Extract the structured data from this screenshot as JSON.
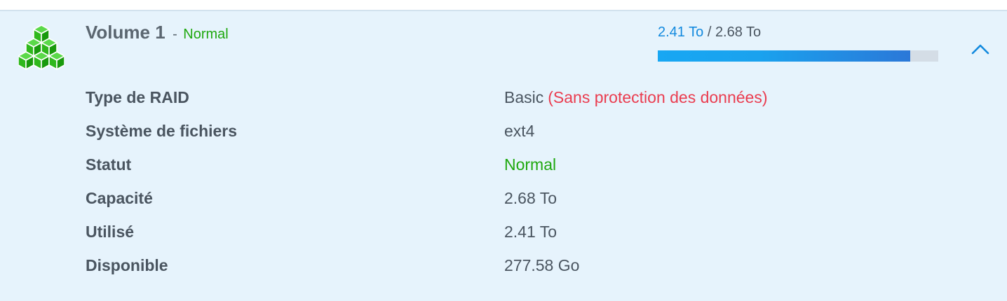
{
  "volume": {
    "name": "Volume 1",
    "separator": "-",
    "status": "Normal",
    "icon": "cubes-icon",
    "icon_color": "#22b60f"
  },
  "usage": {
    "used": "2.41 To",
    "separator": "/",
    "total": "2.68 To",
    "fill_fraction": 0.899,
    "fill_color": "#1aa2ee",
    "track_color": "#d4dde6"
  },
  "collapse": {
    "icon": "chevron-up-icon",
    "color": "#1289de"
  },
  "details": {
    "raid_type": {
      "label": "Type de RAID",
      "value": "Basic",
      "note": "(Sans protection des données)",
      "note_color": "#ea3c4f"
    },
    "file_system": {
      "label": "Système de fichiers",
      "value": "ext4"
    },
    "status": {
      "label": "Statut",
      "value": "Normal",
      "value_color": "#1fa80f"
    },
    "capacity": {
      "label": "Capacité",
      "value": "2.68 To"
    },
    "used": {
      "label": "Utilisé",
      "value": "2.41 To"
    },
    "available": {
      "label": "Disponible",
      "value": "277.58 Go"
    }
  }
}
